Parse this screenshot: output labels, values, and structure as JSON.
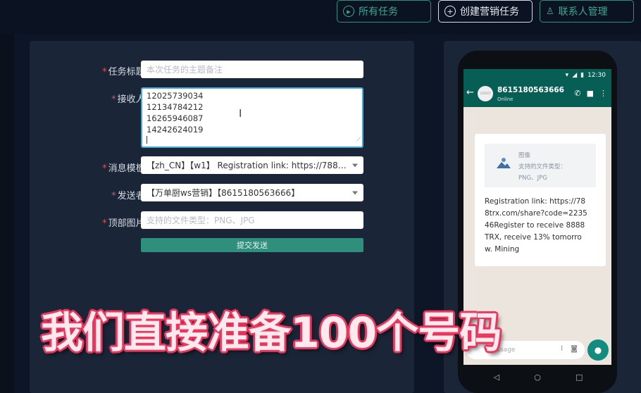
{
  "toolbar": {
    "all_tasks": "所有任务",
    "create_task": "创建营销任务",
    "contacts": "联系人管理"
  },
  "form": {
    "title_label": "任务标题:",
    "title_placeholder": "本次任务的主题备注",
    "recipients_label": "接收人:",
    "recipients": [
      "12025739034",
      "12134784212",
      "16265946087",
      "14242624019"
    ],
    "template_label": "消息模板:",
    "template_value": "【zh_CN】【w1】 Registration link: https://788trx.com/share?code=223546",
    "sender_label": "发送者:",
    "sender_value": "【万单厨ws营销】【8615180563666】",
    "header_image_label": "顶部图片:",
    "header_image_placeholder": "支持的文件类型：PNG、JPG",
    "submit_label": "提交发送"
  },
  "phone": {
    "time": "12:30",
    "contact_name": "8615180563666",
    "contact_status": "Online",
    "avatar_text": "LOGO",
    "image_title": "图像",
    "image_types_label": "支持的文件类型：",
    "image_types": "PNG、JPG",
    "message": "Registration link: https://788trx.com/share?code=223546Register to receive 8888TRX, receive 13% tomorrow. Mining",
    "input_placeholder": "Message"
  },
  "caption": "我们直接准备100个号码",
  "colors": {
    "accent": "#2f8f7d",
    "whatsapp_header": "#075e54",
    "required": "#e0524a"
  }
}
